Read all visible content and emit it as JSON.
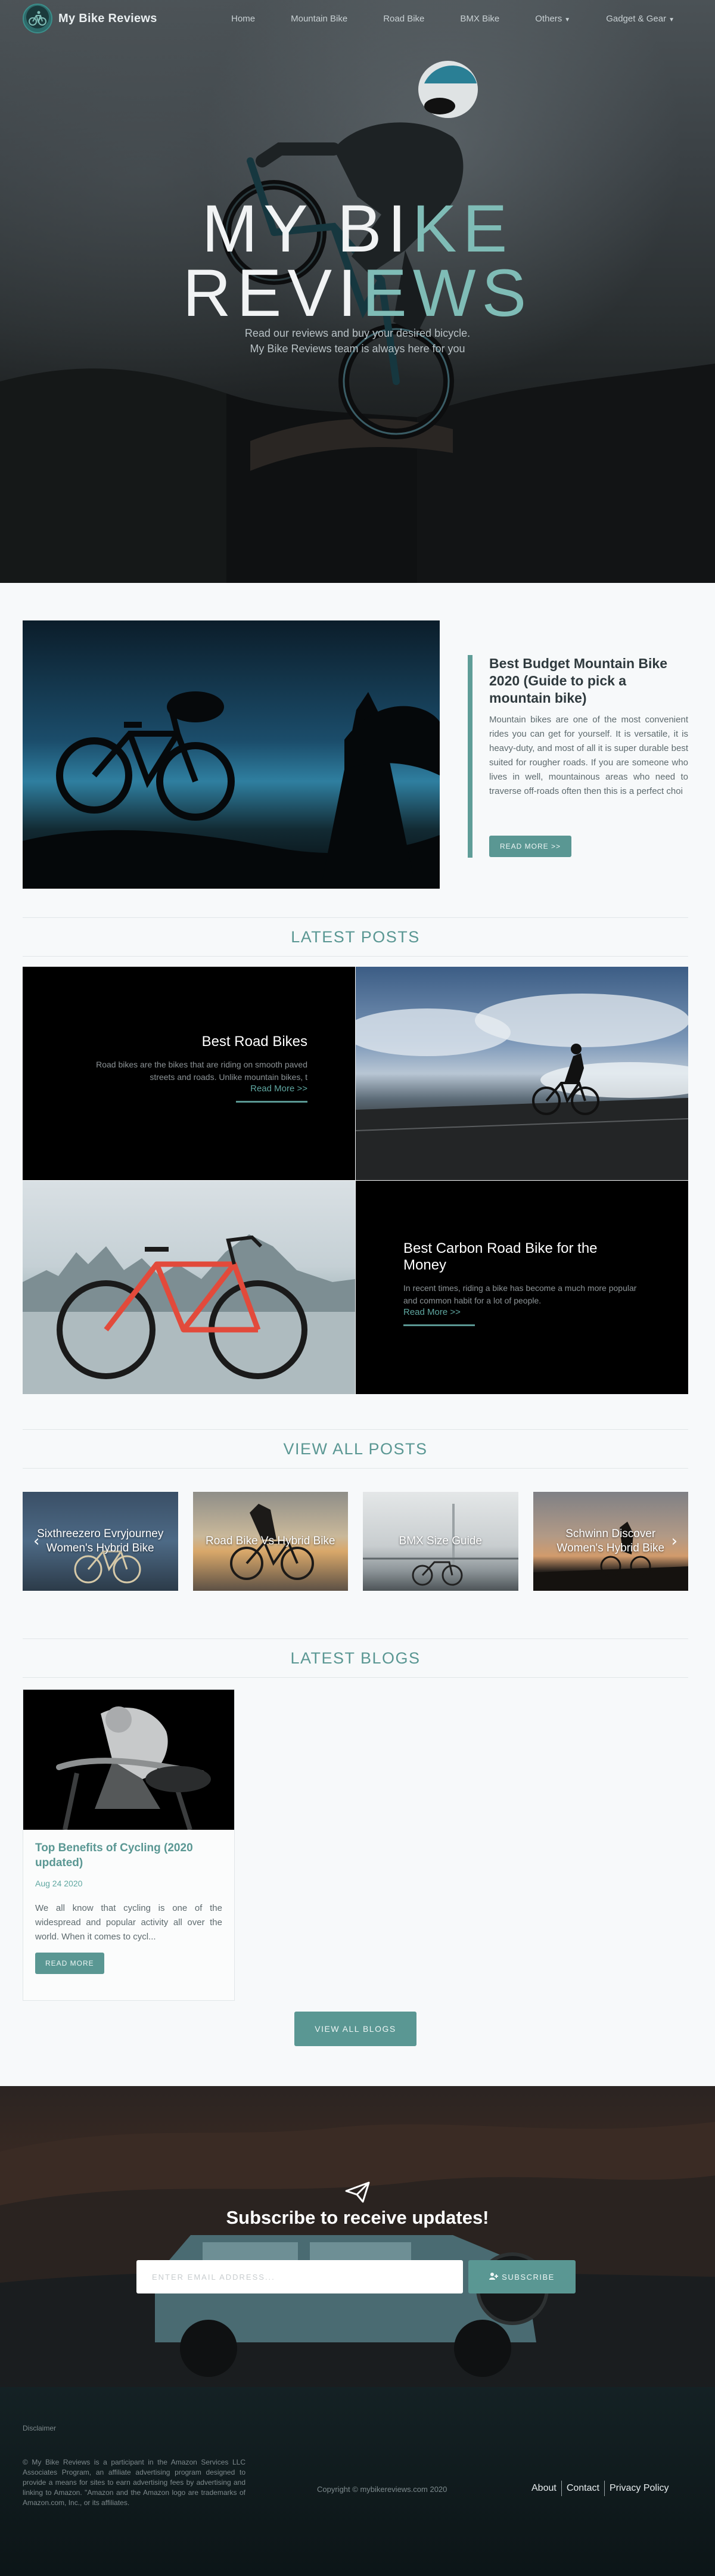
{
  "nav": {
    "brand": "My Bike Reviews",
    "links": [
      "Home",
      "Mountain Bike",
      "Road Bike",
      "BMX Bike",
      "Others",
      "Gadget & Gear"
    ]
  },
  "hero": {
    "title_line1_main": "MY BI",
    "title_line1_accent": "KE",
    "title_line2_main": "REVI",
    "title_line2_accent": "EWS",
    "subtitle_line1": "Read our reviews and buy your desired bicycle.",
    "subtitle_line2": "My Bike Reviews team is always here for you"
  },
  "featured": {
    "title": "Best Budget Mountain Bike 2020 (Guide to pick a mountain bike)",
    "excerpt": "Mountain bikes are one of the most convenient rides you can get for yourself. It is versatile, it is heavy-duty, and most of all it is super durable best suited for rougher roads. If you are someone who lives in well, mountainous areas who need to traverse off-roads often then this is a perfect choi",
    "button": "READ MORE >>"
  },
  "latest_posts": {
    "heading": "LATEST POSTS",
    "posts": [
      {
        "title": "Best Road Bikes",
        "excerpt": "Road bikes are the bikes that are riding on smooth paved streets and roads. Unlike mountain bikes, t",
        "read_more": "Read More >>"
      },
      {
        "title": "Best Carbon Road Bike for the Money",
        "excerpt": "In recent times, riding a bike has become a much more popular and common habit for a lot of people.",
        "read_more": "Read More >>"
      }
    ]
  },
  "view_all_posts": {
    "heading": "VIEW ALL POSTS",
    "items": [
      "Sixthreezero Evryjourney Women's Hybrid Bike",
      "Road Bike Vs Hybrid Bike",
      "BMX Size Guide",
      "Schwinn Discover Women's Hybrid Bike"
    ]
  },
  "latest_blogs": {
    "heading": "LATEST BLOGS",
    "card": {
      "title": "Top Benefits of Cycling (2020 updated)",
      "date": "Aug 24 2020",
      "excerpt": "We all know that cycling is one of the widespread and popular activity all over the world. When it comes to cycl...",
      "button": "READ MORE"
    },
    "view_all": "VIEW ALL BLOGS"
  },
  "subscribe": {
    "title": "Subscribe to receive updates!",
    "placeholder": "ENTER EMAIL ADDRESS...",
    "button": "SUBSCRIBE"
  },
  "footer": {
    "disclaimer_title": "Disclaimer",
    "disclaimer": "© My Bike Reviews is a participant in the Amazon Services LLC Associates Program, an affiliate advertising program designed to provide a means for sites to earn advertising fees by advertising and linking to Amazon. \"Amazon and the Amazon logo are trademarks of Amazon.com, Inc., or its affiliates.",
    "copyright": "Copyright © mybikereviews.com 2020",
    "links": [
      "About",
      "Contact",
      "Privacy Policy"
    ]
  },
  "colors": {
    "accent": "#5a9793",
    "accent_light": "#7fbcb6",
    "footer_bg": "#142124"
  }
}
